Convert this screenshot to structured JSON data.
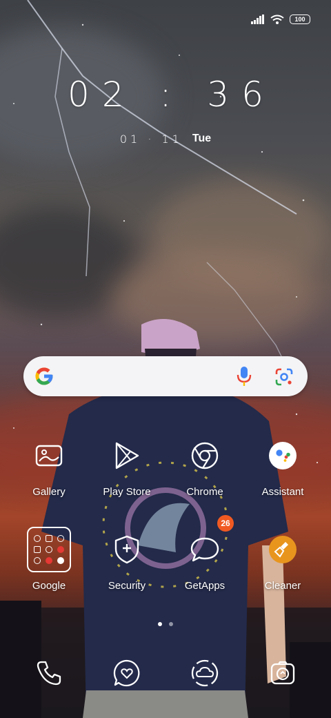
{
  "status_bar": {
    "battery": "100"
  },
  "clock": {
    "time": "02 : 36",
    "date": "01 · 11",
    "day": "Tue"
  },
  "apps": [
    {
      "label": "Gallery",
      "icon": "gallery-icon"
    },
    {
      "label": "Play Store",
      "icon": "play-store-icon"
    },
    {
      "label": "Chrome",
      "icon": "chrome-icon"
    },
    {
      "label": "Assistant",
      "icon": "assistant-icon"
    },
    {
      "label": "Google",
      "icon": "google-folder-icon"
    },
    {
      "label": "Security",
      "icon": "security-icon"
    },
    {
      "label": "GetApps",
      "icon": "getapps-icon",
      "badge": "26"
    },
    {
      "label": "Cleaner",
      "icon": "cleaner-icon"
    }
  ],
  "dock": [
    {
      "icon": "phone-icon"
    },
    {
      "icon": "messaging-icon"
    },
    {
      "icon": "cloud-icon"
    },
    {
      "icon": "camera-icon"
    }
  ],
  "colors": {
    "badge": "#f05a22",
    "cleaner": "#e8951e",
    "google_blue": "#4285f4",
    "google_red": "#ea4335",
    "google_yellow": "#fbbc05",
    "google_green": "#34a853"
  }
}
